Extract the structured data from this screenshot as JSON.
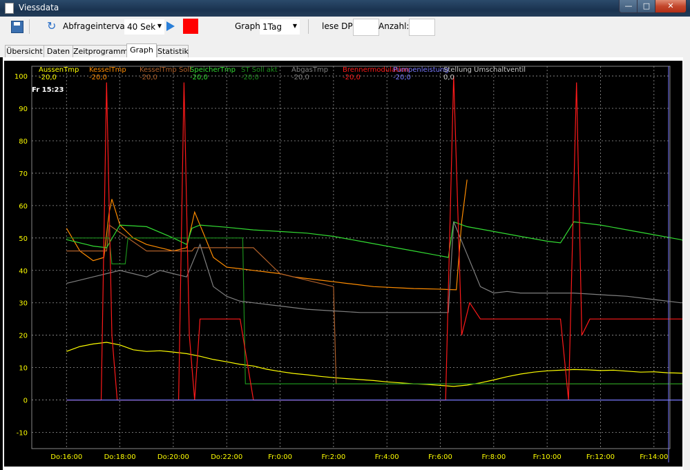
{
  "window": {
    "title": "Viessdata",
    "minimize_glyph": "—",
    "maximize_glyph": "□",
    "close_glyph": "✕"
  },
  "toolbar": {
    "interval_label": "Abfrageintervall:",
    "interval_value": "40 Sek",
    "graph_label": "Graph:",
    "graph_value": "1Tag",
    "read_dp_label": "lese DP:",
    "count_label": "Anzahl:",
    "read_dp_value": "",
    "count_value": ""
  },
  "tabs": [
    {
      "label": "Übersicht",
      "active": false
    },
    {
      "label": "Daten",
      "active": false
    },
    {
      "label": "Zeitprogramme",
      "active": false
    },
    {
      "label": "Graph",
      "active": true
    },
    {
      "label": "Statistik",
      "active": false
    }
  ],
  "chart_data": {
    "type": "line",
    "cursor_time": "Fr 15:23",
    "ylim": [
      -15,
      103
    ],
    "y_ticks": [
      100,
      90,
      80,
      70,
      60,
      50,
      40,
      30,
      20,
      10,
      0,
      -10
    ],
    "x_ticks": [
      "Do:16:00",
      "Do:18:00",
      "Do:20:00",
      "Do:22:00",
      "Fr:0:00",
      "Fr:2:00",
      "Fr:4:00",
      "Fr:6:00",
      "Fr:8:00",
      "Fr:10:00",
      "Fr:12:00",
      "Fr:14:00"
    ],
    "x_range_hours": [
      -1.3,
      22.6
    ],
    "legend": [
      {
        "name": "AussenTmp",
        "value": "-20,0",
        "color": "#ffff00"
      },
      {
        "name": "KesselTmp",
        "value": "-20,0",
        "color": "#ff8c00"
      },
      {
        "name": "KesselTmp Soll",
        "value": "-20,0",
        "color": "#b0602a"
      },
      {
        "name": "SpeicherTmp",
        "value": "-20,0",
        "color": "#33dd33"
      },
      {
        "name": "ST Soll akt",
        "value": "-20,0",
        "color": "#1c8f1c"
      },
      {
        "name": "AbgasTmp",
        "value": "-20,0",
        "color": "#808080"
      },
      {
        "name": "Brennermodulation",
        "value": "-20,0",
        "color": "#ff1a1a"
      },
      {
        "name": "Pumpenleistung",
        "value": "-20,0",
        "color": "#7a7aff"
      },
      {
        "name": "Stellung Umschaltventil",
        "value": "0,0",
        "color": "#c8c8c8"
      }
    ],
    "series": [
      {
        "name": "AussenTmp",
        "color": "#ffff00",
        "x": [
          0,
          0.5,
          1,
          1.5,
          2,
          2.5,
          3,
          3.5,
          4,
          4.5,
          5,
          5.5,
          6,
          6.5,
          7,
          7.5,
          8,
          8.5,
          9,
          9.5,
          10,
          10.5,
          11,
          11.5,
          12,
          12.5,
          13,
          13.5,
          14,
          14.5,
          15,
          15.5,
          16,
          16.5,
          17,
          17.5,
          18,
          18.5,
          19,
          19.5,
          20,
          20.5,
          21,
          21.5,
          22,
          22.5,
          23,
          23.4
        ],
        "y": [
          15,
          16.5,
          17.3,
          17.8,
          17,
          15.5,
          15,
          15.2,
          14.8,
          14.3,
          13.5,
          12.5,
          11.8,
          11,
          10.5,
          9.5,
          8.8,
          8.2,
          7.8,
          7.3,
          6.9,
          6.6,
          6.3,
          6,
          5.6,
          5.3,
          5,
          4.8,
          4.5,
          4.2,
          4.6,
          5.3,
          6.2,
          7.2,
          8,
          8.6,
          9,
          9.2,
          9.4,
          9.3,
          9.1,
          9.2,
          8.9,
          8.6,
          8.7,
          8.4,
          8.3,
          8.2
        ]
      },
      {
        "name": "KesselTmp",
        "color": "#ff8c00",
        "x": [
          0,
          0.5,
          1,
          1.4,
          1.6,
          1.7,
          2,
          2.5,
          3,
          3.5,
          4,
          4.5,
          4.8,
          5,
          5.5,
          6,
          6.5,
          7,
          7.5,
          8,
          8.5,
          9,
          9.5,
          10,
          10.5,
          11,
          11.5,
          12,
          12.5,
          13,
          13.5,
          14,
          14.3,
          14.6,
          14.8,
          15
        ],
        "y": [
          53,
          46,
          43,
          44,
          58,
          62,
          54,
          50,
          48,
          47,
          46,
          47,
          58,
          54,
          44,
          41,
          40.5,
          40,
          39.5,
          39,
          38,
          37.5,
          37,
          36.5,
          36,
          35.5,
          35,
          34.8,
          34.6,
          34.4,
          34.3,
          34.2,
          34.1,
          34,
          55,
          68
        ]
      },
      {
        "name": "KesselTmp Soll",
        "color": "#b0602a",
        "x": [
          0,
          1.5,
          1.6,
          3,
          4.7,
          4.8,
          7,
          8,
          9,
          10,
          10.1,
          11,
          12,
          13,
          14,
          14.2,
          14.3,
          23.4
        ],
        "y": [
          46,
          46,
          54,
          46,
          46,
          47,
          47,
          39,
          37,
          35,
          5,
          5,
          5,
          5,
          5,
          5,
          5,
          5
        ]
      },
      {
        "name": "SpeicherTmp",
        "color": "#33dd33",
        "x": [
          0,
          1,
          1.5,
          2,
          3,
          4,
          4.5,
          4.7,
          5,
          6,
          7,
          8,
          9,
          10,
          11,
          12,
          13,
          14,
          14.3,
          14.5,
          15,
          16,
          17,
          18,
          18.5,
          19,
          20,
          21,
          22,
          23,
          23.4
        ],
        "y": [
          49.5,
          47.5,
          47,
          54,
          53.5,
          50,
          48,
          53,
          54,
          53.3,
          52.5,
          52,
          51.5,
          50.5,
          49,
          47.5,
          46,
          44.5,
          44,
          55,
          53.5,
          52,
          50.5,
          49,
          48.5,
          55,
          54,
          52.5,
          51,
          49.5,
          48.5
        ]
      },
      {
        "name": "ST Soll akt",
        "color": "#1c8f1c",
        "x": [
          0,
          1.6,
          1.7,
          2.2,
          2.3,
          4.6,
          4.7,
          6.6,
          6.7,
          23.4
        ],
        "y": [
          50,
          50,
          42,
          42,
          50,
          50,
          50,
          50,
          5,
          5
        ]
      },
      {
        "name": "AbgasTmp",
        "color": "#808080",
        "x": [
          0,
          0.5,
          1,
          1.5,
          2,
          2.5,
          3,
          3.5,
          4,
          4.5,
          5,
          5.5,
          6,
          6.5,
          7,
          7.5,
          8,
          9,
          10,
          11,
          12,
          13,
          14,
          14.3,
          14.5,
          15,
          15.5,
          16,
          16.5,
          17,
          18,
          19,
          20,
          21,
          22,
          23,
          23.4
        ],
        "y": [
          36,
          37,
          38,
          39,
          40,
          39,
          38,
          40,
          39,
          38,
          48,
          35,
          32,
          30.5,
          30,
          29.5,
          29,
          28,
          27.5,
          27,
          27,
          27,
          27,
          27,
          55,
          45,
          35,
          33,
          33.5,
          33,
          33,
          33,
          32.5,
          32,
          31,
          30,
          30
        ]
      },
      {
        "name": "Brennermodulation",
        "color": "#ff1a1a",
        "x": [
          0,
          1.3,
          1.5,
          1.7,
          1.9,
          2.5,
          3,
          4.2,
          4.4,
          4.6,
          4.8,
          5,
          5.5,
          6,
          6.5,
          7,
          14.2,
          14.5,
          14.8,
          15.1,
          15.5,
          16,
          16.5,
          17,
          17.5,
          18,
          18.5,
          18.8,
          19.1,
          19.3,
          19.6,
          20,
          21,
          22,
          23.3,
          23.4
        ],
        "y": [
          0,
          0,
          98,
          20,
          0,
          0,
          0,
          0,
          98,
          20,
          0,
          25,
          25,
          25,
          25,
          0,
          0,
          100,
          20,
          30,
          25,
          25,
          25,
          25,
          25,
          25,
          25,
          0,
          98,
          20,
          25,
          25,
          25,
          25,
          25,
          0
        ]
      },
      {
        "name": "Pumpenleistung",
        "color": "#7a7aff",
        "x": [
          0,
          23.4
        ],
        "y": [
          0,
          0
        ]
      }
    ]
  }
}
